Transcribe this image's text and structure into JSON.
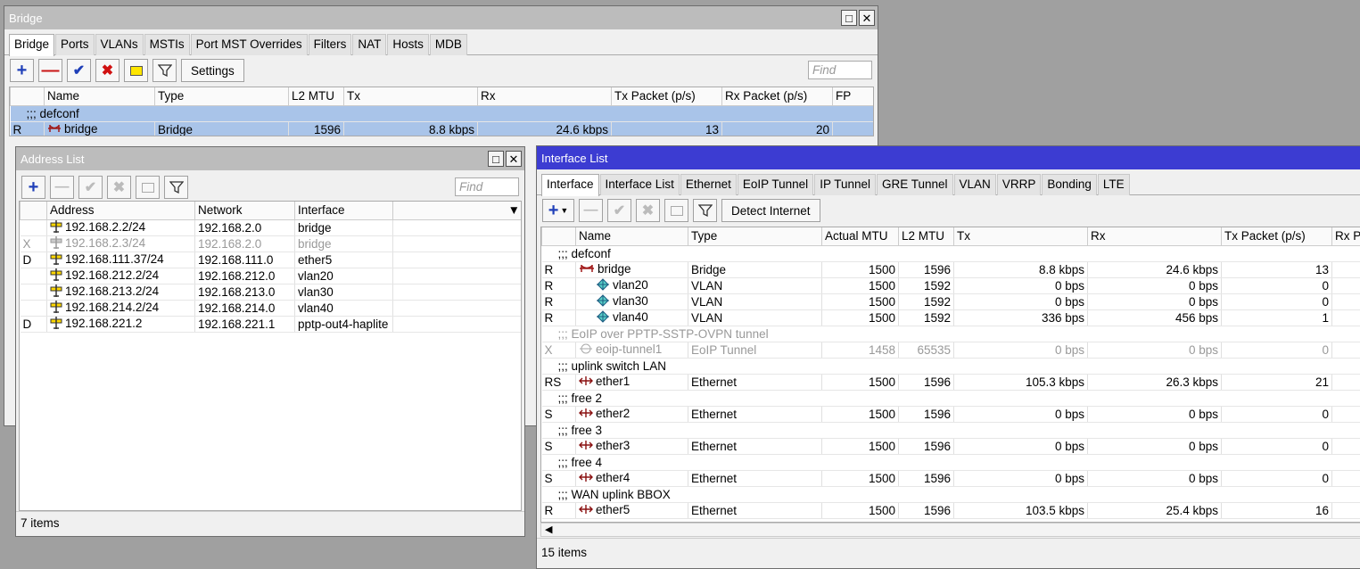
{
  "bridge_window": {
    "title": "Bridge",
    "tabs": [
      "Bridge",
      "Ports",
      "VLANs",
      "MSTIs",
      "Port MST Overrides",
      "Filters",
      "NAT",
      "Hosts",
      "MDB"
    ],
    "settings_label": "Settings",
    "find_placeholder": "Find",
    "columns": [
      "Name",
      "Type",
      "L2 MTU",
      "Tx",
      "Rx",
      "Tx Packet (p/s)",
      "Rx Packet (p/s)",
      "FP"
    ],
    "comment": ";;; defconf",
    "row": {
      "flag": "R",
      "name": "bridge",
      "type": "Bridge",
      "l2mtu": "1596",
      "tx": "8.8 kbps",
      "rx": "24.6 kbps",
      "txp": "13",
      "rxp": "20",
      "fp": ""
    }
  },
  "address_window": {
    "title": "Address List",
    "find_placeholder": "Find",
    "columns": [
      "Address",
      "Network",
      "Interface"
    ],
    "rows": [
      {
        "flag": "",
        "address": "192.168.2.2/24",
        "network": "192.168.2.0",
        "iface": "bridge"
      },
      {
        "flag": "X",
        "address": "192.168.2.3/24",
        "network": "192.168.2.0",
        "iface": "bridge"
      },
      {
        "flag": "D",
        "address": "192.168.111.37/24",
        "network": "192.168.111.0",
        "iface": "ether5"
      },
      {
        "flag": "",
        "address": "192.168.212.2/24",
        "network": "192.168.212.0",
        "iface": "vlan20"
      },
      {
        "flag": "",
        "address": "192.168.213.2/24",
        "network": "192.168.213.0",
        "iface": "vlan30"
      },
      {
        "flag": "",
        "address": "192.168.214.2/24",
        "network": "192.168.214.0",
        "iface": "vlan40"
      },
      {
        "flag": "D",
        "address": "192.168.221.2",
        "network": "192.168.221.1",
        "iface": "pptp-out4-haplite"
      }
    ],
    "status": "7 items"
  },
  "interface_window": {
    "title": "Interface List",
    "tabs": [
      "Interface",
      "Interface List",
      "Ethernet",
      "EoIP Tunnel",
      "IP Tunnel",
      "GRE Tunnel",
      "VLAN",
      "VRRP",
      "Bonding",
      "LTE"
    ],
    "detect_label": "Detect Internet",
    "columns": [
      "Name",
      "Type",
      "Actual MTU",
      "L2 MTU",
      "Tx",
      "Rx",
      "Tx Packet (p/s)",
      "Rx P"
    ],
    "rows": [
      {
        "kind": "comment",
        "text": ";;; defconf"
      },
      {
        "flag": "R",
        "name": "bridge",
        "icon": "bridge",
        "indent": 0,
        "type": "Bridge",
        "mtu": "1500",
        "l2mtu": "1596",
        "tx": "8.8 kbps",
        "rx": "24.6 kbps",
        "txp": "13"
      },
      {
        "flag": "R",
        "name": "vlan20",
        "icon": "vlan",
        "indent": 1,
        "type": "VLAN",
        "mtu": "1500",
        "l2mtu": "1592",
        "tx": "0 bps",
        "rx": "0 bps",
        "txp": "0"
      },
      {
        "flag": "R",
        "name": "vlan30",
        "icon": "vlan",
        "indent": 1,
        "type": "VLAN",
        "mtu": "1500",
        "l2mtu": "1592",
        "tx": "0 bps",
        "rx": "0 bps",
        "txp": "0"
      },
      {
        "flag": "R",
        "name": "vlan40",
        "icon": "vlan",
        "indent": 1,
        "type": "VLAN",
        "mtu": "1500",
        "l2mtu": "1592",
        "tx": "336 bps",
        "rx": "456 bps",
        "txp": "1"
      },
      {
        "kind": "comment",
        "text": ";;; EoIP over PPTP-SSTP-OVPN tunnel",
        "disabled": true
      },
      {
        "flag": "X",
        "name": "eoip-tunnel1",
        "icon": "eoip",
        "indent": 0,
        "type": "EoIP Tunnel",
        "mtu": "1458",
        "l2mtu": "65535",
        "tx": "0 bps",
        "rx": "0 bps",
        "txp": "0",
        "disabled": true
      },
      {
        "kind": "comment",
        "text": ";;; uplink switch LAN"
      },
      {
        "flag": "RS",
        "name": "ether1",
        "icon": "ether",
        "indent": 0,
        "type": "Ethernet",
        "mtu": "1500",
        "l2mtu": "1596",
        "tx": "105.3 kbps",
        "rx": "26.3 kbps",
        "txp": "21"
      },
      {
        "kind": "comment",
        "text": ";;; free 2"
      },
      {
        "flag": "S",
        "name": "ether2",
        "icon": "ether",
        "indent": 0,
        "type": "Ethernet",
        "mtu": "1500",
        "l2mtu": "1596",
        "tx": "0 bps",
        "rx": "0 bps",
        "txp": "0"
      },
      {
        "kind": "comment",
        "text": ";;; free 3"
      },
      {
        "flag": "S",
        "name": "ether3",
        "icon": "ether",
        "indent": 0,
        "type": "Ethernet",
        "mtu": "1500",
        "l2mtu": "1596",
        "tx": "0 bps",
        "rx": "0 bps",
        "txp": "0"
      },
      {
        "kind": "comment",
        "text": ";;; free 4"
      },
      {
        "flag": "S",
        "name": "ether4",
        "icon": "ether",
        "indent": 0,
        "type": "Ethernet",
        "mtu": "1500",
        "l2mtu": "1596",
        "tx": "0 bps",
        "rx": "0 bps",
        "txp": "0"
      },
      {
        "kind": "comment",
        "text": ";;; WAN uplink BBOX"
      },
      {
        "flag": "R",
        "name": "ether5",
        "icon": "ether",
        "indent": 0,
        "type": "Ethernet",
        "mtu": "1500",
        "l2mtu": "1596",
        "tx": "103.5 kbps",
        "rx": "25.4 kbps",
        "txp": "16"
      }
    ],
    "status": "15 items"
  }
}
